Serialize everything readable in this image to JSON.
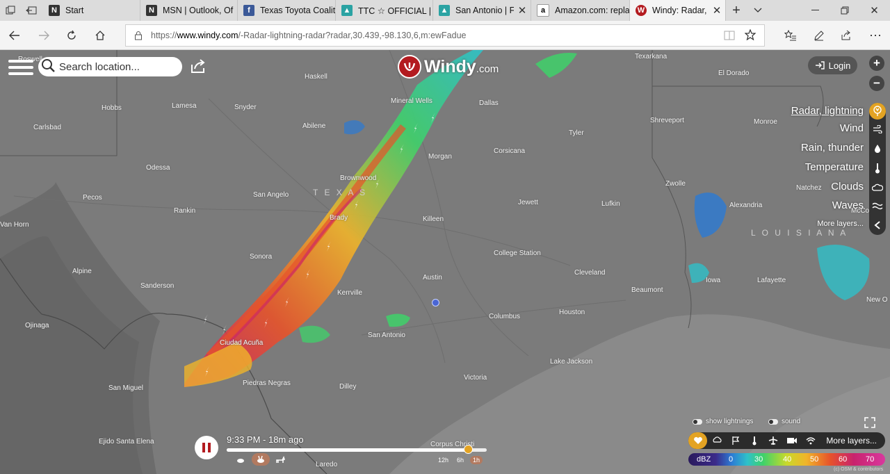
{
  "browser": {
    "tabs": [
      {
        "title": "Start",
        "favicon": "edge-start-icon",
        "active": false
      },
      {
        "title": "MSN | Outlook, Of",
        "favicon": "msn-icon",
        "active": false
      },
      {
        "title": "Texas Toyota Coalit",
        "favicon": "facebook-icon",
        "active": false
      },
      {
        "title": "TTC ☆ OFFICIAL | F",
        "favicon": "ttc-icon",
        "active": false
      },
      {
        "title": "San Antonio | F",
        "favicon": "ttc-icon",
        "active": false
      },
      {
        "title": "Amazon.com: repla",
        "favicon": "amazon-icon",
        "active": false
      },
      {
        "title": "Windy: Radar, l",
        "favicon": "windy-icon",
        "active": true
      }
    ],
    "url_prefix": "https://",
    "url_domain": "www.windy.com",
    "url_path": "/-Radar-lightning-radar?radar,30.439,-98.130,6,m:ewFadue"
  },
  "map": {
    "search_placeholder": "Search location...",
    "logo_text": "Windy",
    "logo_suffix": ".com",
    "login_label": "Login",
    "layers": [
      {
        "label": "Radar, lightning",
        "icon": "radar-icon",
        "active": true
      },
      {
        "label": "Wind",
        "icon": "wind-icon",
        "active": false
      },
      {
        "label": "Rain, thunder",
        "icon": "rain-drop-icon",
        "active": false
      },
      {
        "label": "Temperature",
        "icon": "thermometer-icon",
        "active": false
      },
      {
        "label": "Clouds",
        "icon": "cloud-icon",
        "active": false
      },
      {
        "label": "Waves",
        "icon": "waves-icon",
        "active": false
      },
      {
        "label": "More layers...",
        "icon": "chevron-left-icon",
        "active": false
      }
    ],
    "region_labels": [
      "T E X A S",
      "L O U I S I A N A"
    ],
    "cities": [
      "Roswell",
      "Texarkana",
      "El Dorado",
      "Haskell",
      "Hobbs",
      "Lamesa",
      "Snyder",
      "Mineral Wells",
      "Dallas",
      "Carlsbad",
      "Abilene",
      "Tyler",
      "Shreveport",
      "Monroe",
      "Corsicana",
      "Morgan",
      "Odessa",
      "Brownwood",
      "Zwolle",
      "San Angelo",
      "Natchez",
      "Pecos",
      "Jewett",
      "Lufkin",
      "Alexandria",
      "Rankin",
      "Brady",
      "Killeen",
      "Van Horn",
      "College Station",
      "Sonora",
      "Cleveland",
      "Alpine",
      "Austin",
      "Iowa",
      "Lafayette",
      "Sanderson",
      "Kerrville",
      "Beaumont",
      "New O",
      "Houston",
      "Columbus",
      "Ojinaga",
      "Ciudad Acuña",
      "San Antonio",
      "Lake Jackson",
      "Piedras Negras",
      "Dilley",
      "Victoria",
      "San Miguel",
      "Ejido Santa Elena",
      "Corpus Christi",
      "Laredo",
      "McCo"
    ],
    "timestamp": "9:33 PM - 18m ago",
    "timeline_progress": 0.93,
    "ranges": [
      {
        "label": "12h",
        "active": false
      },
      {
        "label": "6h",
        "active": false
      },
      {
        "label": "1h",
        "active": true
      }
    ],
    "show_lightnings": "show lightnings",
    "sound": "sound",
    "more_layers_label": "More layers...",
    "scale_unit": "dBZ",
    "scale_ticks": [
      "0",
      "30",
      "40",
      "50",
      "60",
      "70"
    ],
    "attribution": "(c) OSM & contributors",
    "colors": {
      "accent": "#e3a323",
      "logo_red": "#b31b20",
      "location_dot": "#4a66d4"
    }
  }
}
